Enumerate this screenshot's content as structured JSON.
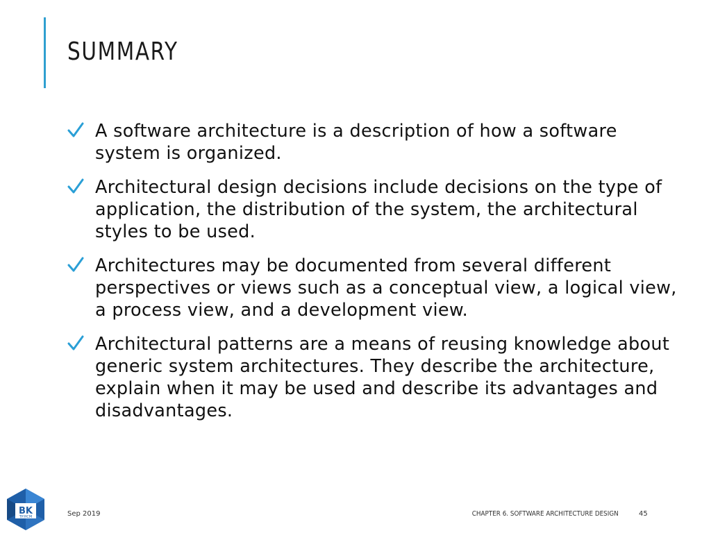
{
  "slide": {
    "title": "SUMMARY",
    "bullets": [
      {
        "text": "A software architecture is a description of how a software system is organized."
      },
      {
        "text": "Architectural design decisions include decisions on the type of application, the distribution of the system, the architectural styles to be used."
      },
      {
        "text": "Architectures may be documented from several different perspectives or views such as a conceptual view, a logical view, a process view, and a development view."
      },
      {
        "text": "Architectural patterns are a means of reusing knowledge about generic system architectures. They describe the architecture, explain when it may be used and describe its advantages and disadvantages."
      }
    ]
  },
  "footer": {
    "date": "Sep 2019",
    "chapter": "CHAPTER 6. SOFTWARE ARCHITECTURE DESIGN",
    "page": "45",
    "logo_text": "BK",
    "logo_subtext": "TP.HCM"
  },
  "colors": {
    "accent": "#2f9fd0",
    "check": "#2a9fd6",
    "logo_blue": "#1f5fa8"
  },
  "icons": {
    "bullet": "checkmark-icon",
    "logo": "bk-hexagon-logo"
  }
}
